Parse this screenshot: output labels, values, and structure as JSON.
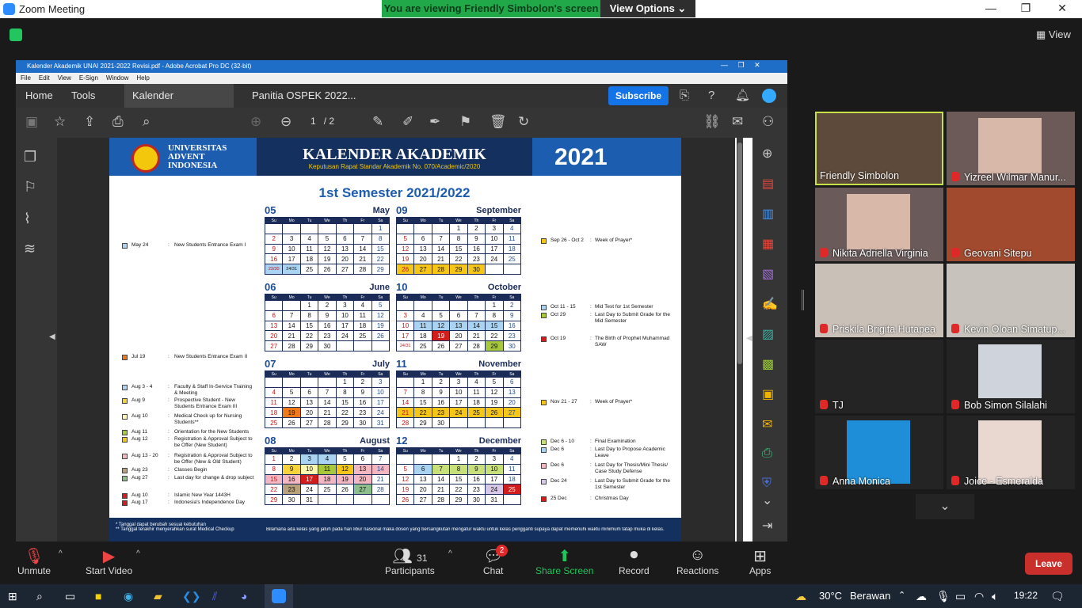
{
  "window": {
    "title": "Zoom Meeting"
  },
  "zoom": {
    "banner": "You are viewing Friendly Simbolon's screen",
    "view_options": "View Options",
    "view_label": "View",
    "leave_label": "Leave"
  },
  "acrobat": {
    "title": "Kalender Akademik UNAI 2021-2022 Revisi.pdf - Adobe Acrobat Pro DC (32-bit)",
    "menu": [
      "File",
      "Edit",
      "View",
      "E-Sign",
      "Window",
      "Help"
    ],
    "tabs": {
      "home": "Home",
      "tools": "Tools",
      "doc1": "Kalender Akademik...",
      "doc2": "Panitia OSPEK 2022..."
    },
    "subscribe": "Subscribe",
    "page_current": "1",
    "page_total": "/ 2"
  },
  "calendar": {
    "uni_name": [
      "UNIVERSITAS",
      "ADVENT",
      "INDONESIA"
    ],
    "title": "KALENDER AKADEMIK",
    "subtitle": "Keputusan Rapat Standar Akademik No. 070/Academic/2020",
    "year": "2021",
    "semester": "1st Semester 2021/2022",
    "weekdays": [
      "Su",
      "Mo",
      "Tu",
      "We",
      "Th",
      "Fr",
      "Sa"
    ],
    "months": [
      {
        "num": "05",
        "name": "May",
        "rows": [
          [
            "",
            "",
            "",
            "",
            "",
            "",
            "1"
          ],
          [
            "2",
            "3",
            "4",
            "5",
            "6",
            "7",
            "8"
          ],
          [
            "9",
            "10",
            "11",
            "12",
            "13",
            "14",
            "15"
          ],
          [
            "16",
            "17",
            "18",
            "19",
            "20",
            "21",
            "22"
          ],
          [
            "23/30",
            "24/31",
            "25",
            "26",
            "27",
            "28",
            "29"
          ]
        ]
      },
      {
        "num": "06",
        "name": "June",
        "rows": [
          [
            "",
            "",
            "1",
            "2",
            "3",
            "4",
            "5"
          ],
          [
            "6",
            "7",
            "8",
            "9",
            "10",
            "11",
            "12"
          ],
          [
            "13",
            "14",
            "15",
            "16",
            "17",
            "18",
            "19"
          ],
          [
            "20",
            "21",
            "22",
            "23",
            "24",
            "25",
            "26"
          ],
          [
            "27",
            "28",
            "29",
            "30",
            "",
            "",
            ""
          ]
        ]
      },
      {
        "num": "07",
        "name": "July",
        "rows": [
          [
            "",
            "",
            "",
            "",
            "1",
            "2",
            "3"
          ],
          [
            "4",
            "5",
            "6",
            "7",
            "8",
            "9",
            "10"
          ],
          [
            "11",
            "12",
            "13",
            "14",
            "15",
            "16",
            "17"
          ],
          [
            "18",
            "19",
            "20",
            "21",
            "22",
            "23",
            "24"
          ],
          [
            "25",
            "26",
            "27",
            "28",
            "29",
            "30",
            "31"
          ]
        ]
      },
      {
        "num": "08",
        "name": "August",
        "rows": [
          [
            "1",
            "2",
            "3",
            "4",
            "5",
            "6",
            "7"
          ],
          [
            "8",
            "9",
            "10",
            "11",
            "12",
            "13",
            "14"
          ],
          [
            "15",
            "16",
            "17",
            "18",
            "19",
            "20",
            "21"
          ],
          [
            "22",
            "23",
            "24",
            "25",
            "26",
            "27",
            "28"
          ],
          [
            "29",
            "30",
            "31",
            "",
            "",
            "",
            ""
          ]
        ]
      },
      {
        "num": "09",
        "name": "September",
        "rows": [
          [
            "",
            "",
            "",
            "1",
            "2",
            "3",
            "4"
          ],
          [
            "5",
            "6",
            "7",
            "8",
            "9",
            "10",
            "11"
          ],
          [
            "12",
            "13",
            "14",
            "15",
            "16",
            "17",
            "18"
          ],
          [
            "19",
            "20",
            "21",
            "22",
            "23",
            "24",
            "25"
          ],
          [
            "26",
            "27",
            "28",
            "29",
            "30",
            "",
            ""
          ]
        ]
      },
      {
        "num": "10",
        "name": "October",
        "rows": [
          [
            "",
            "",
            "",
            "",
            "",
            "1",
            "2"
          ],
          [
            "3",
            "4",
            "5",
            "6",
            "7",
            "8",
            "9"
          ],
          [
            "10",
            "11",
            "12",
            "13",
            "14",
            "15",
            "16"
          ],
          [
            "17",
            "18",
            "19",
            "20",
            "21",
            "22",
            "23"
          ],
          [
            "24/31",
            "25",
            "26",
            "27",
            "28",
            "29",
            "30"
          ]
        ]
      },
      {
        "num": "11",
        "name": "November",
        "rows": [
          [
            "",
            "1",
            "2",
            "3",
            "4",
            "5",
            "6"
          ],
          [
            "7",
            "8",
            "9",
            "10",
            "11",
            "12",
            "13"
          ],
          [
            "14",
            "15",
            "16",
            "17",
            "18",
            "19",
            "20"
          ],
          [
            "21",
            "22",
            "23",
            "24",
            "25",
            "26",
            "27"
          ],
          [
            "28",
            "29",
            "30",
            "",
            "",
            "",
            ""
          ]
        ]
      },
      {
        "num": "12",
        "name": "December",
        "rows": [
          [
            "",
            "",
            "",
            "1",
            "2",
            "3",
            "4"
          ],
          [
            "5",
            "6",
            "7",
            "8",
            "9",
            "10",
            "11"
          ],
          [
            "12",
            "13",
            "14",
            "15",
            "16",
            "17",
            "18"
          ],
          [
            "19",
            "20",
            "21",
            "22",
            "23",
            "24",
            "25"
          ],
          [
            "26",
            "27",
            "28",
            "29",
            "30",
            "31",
            ""
          ]
        ]
      }
    ],
    "left_events": [
      {
        "date": "May 24",
        "text": "New Students Entrance Exam I",
        "color": "#a9d3f0"
      },
      {
        "date": "Jul 19",
        "text": "New Students Entrance Exam II",
        "color": "#f07a1a"
      },
      {
        "date": "Aug 3 - 4",
        "text": "Faculty & Staff In-Service Training & Meeting",
        "color": "#a9d3f0"
      },
      {
        "date": "Aug 9",
        "text": "Prospective Student - New Students Entrance Exam III",
        "color": "#f7d33b"
      },
      {
        "date": "Aug 10",
        "text": "Medical Check up for Nursing Students**",
        "color": "#fff7b0"
      },
      {
        "date": "Aug 11",
        "text": "Orientation for the New Students",
        "color": "#a6c83a"
      },
      {
        "date": "Aug 12",
        "text": "Registration & Approval Subject to be Offer (New Student)",
        "color": "#f5c518"
      },
      {
        "date": "Aug 13 - 20",
        "text": "Registration & Approval Subject to be Offer (New & Old Student)",
        "color": "#f4b6c0"
      },
      {
        "date": "Aug 23",
        "text": "Classes Begin",
        "color": "#b8a07a"
      },
      {
        "date": "Aug 27",
        "text": "Last day for change & drop subject",
        "color": "#8dbf8d"
      },
      {
        "date": "Aug 10",
        "text": "Islamic New Year 1443H",
        "color": "#d21d1d"
      },
      {
        "date": "Aug 17",
        "text": "Indonesia's Independence Day",
        "color": "#d21d1d"
      }
    ],
    "right_events": [
      {
        "date": "Sep 26 - Oct 2",
        "text": "Week of Prayer*",
        "color": "#f5c518"
      },
      {
        "date": "Oct 11 - 15",
        "text": "Mid Test for 1st Semester",
        "color": "#a9d3f0"
      },
      {
        "date": "Oct 29",
        "text": "Last Day to Submit Grade for the Mid Semester",
        "color": "#a6c83a"
      },
      {
        "date": "Oct 19",
        "text": "The Birth of Prophet Muhammad SAW",
        "color": "#d21d1d"
      },
      {
        "date": "Nov 21 - 27",
        "text": "Week of Prayer*",
        "color": "#f5c518"
      },
      {
        "date": "Dec 6 - 10",
        "text": "Final Examination",
        "color": "#c8e07a"
      },
      {
        "date": "Dec 6",
        "text": "Last Day to Propose Academic Leave",
        "color": "#a9d3f0"
      },
      {
        "date": "Dec 6",
        "text": "Last Day for Thesis/Mini Thesis/ Case Study Defense",
        "color": "#f4b6c0"
      },
      {
        "date": "Dec 24",
        "text": "Last Day to Submit Grade for the 1st Semester",
        "color": "#d8c8e8"
      },
      {
        "date": "25 Dec",
        "text": "Christmas Day",
        "color": "#d21d1d"
      }
    ],
    "footer_notes": [
      "* Tanggal dapat berubah sesuai kebutuhan",
      "** Tanggal terakhir menyerahkan surat Medical Checkup"
    ],
    "footer_text": "Bilamana ada kelas yang jatuh pada hari libur nasional maka dosen yang bersangkutan mengatur waktu untuk kelas pengganti supaya dapat memenuhi waktu minimum tatap muka di kelas."
  },
  "participants": [
    "Friendly Simbolon",
    "Yizreel Wilmar Manur...",
    "Nikita Adriella Virginia",
    "Geovani Sitepu",
    "Priskila Brigita Hutapea",
    "Kevin Oloan Simatup...",
    "TJ",
    "Bob Simon Silalahi",
    "Anna Monica",
    "Joice - Esmeralda"
  ],
  "toolbar": {
    "unmute": "Unmute",
    "start_video": "Start Video",
    "participants": "Participants",
    "participants_count": "31",
    "chat": "Chat",
    "chat_badge": "2",
    "share": "Share Screen",
    "record": "Record",
    "reactions": "Reactions",
    "apps": "Apps"
  },
  "taskbar": {
    "weather": "30°C",
    "weather_desc": "Berawan",
    "time": "19:22"
  }
}
